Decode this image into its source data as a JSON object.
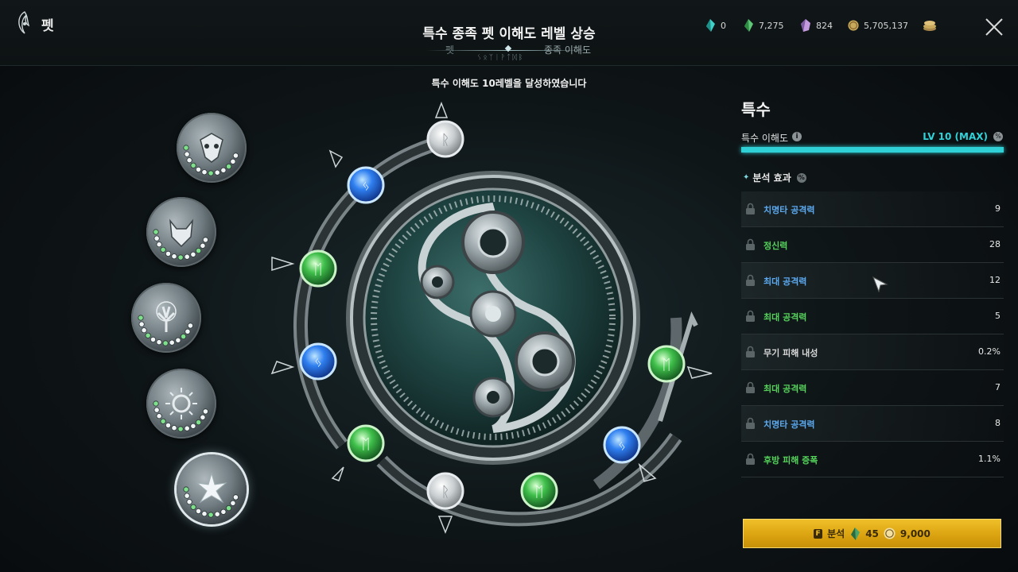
{
  "header": {
    "app_title": "펫",
    "center_title": "특수 종족 펫 이해도 레벨 상승",
    "tabs": [
      {
        "label": "펫"
      },
      {
        "label": "종족 이해도"
      }
    ],
    "rune_text": "ᛊᛟᛉᛁᚹᛏᛞᛒ"
  },
  "currencies": [
    {
      "icon": "blue-crystal-icon",
      "value": "0",
      "color": "#3fd0c8"
    },
    {
      "icon": "green-crystal-icon",
      "value": "7,275",
      "color": "#5fc878"
    },
    {
      "icon": "purple-crystal-icon",
      "value": "824",
      "color": "#c49adf"
    },
    {
      "icon": "gold-coin-icon",
      "value": "5,705,137",
      "color": "#d6b45a"
    },
    {
      "icon": "coin-stack-icon",
      "value": "",
      "color": "#c9a95b"
    }
  ],
  "toast": "특수 이해도 10레벨을 달성하였습니다",
  "species_nodes": [
    {
      "icon": "owl-mask-icon"
    },
    {
      "icon": "wolf-head-icon"
    },
    {
      "icon": "tree-icon"
    },
    {
      "icon": "sun-swirl-icon"
    },
    {
      "icon": "star-flower-icon",
      "selected": true
    }
  ],
  "panel": {
    "title": "특수",
    "understanding_label": "특수 이해도",
    "level_text": "LV 10 (MAX)",
    "progress": 1.0,
    "section_title": "분석 효과",
    "effects": [
      {
        "name": "치명타 공격력",
        "value": "9",
        "color": "#5aa9f0"
      },
      {
        "name": "정신력",
        "value": "28",
        "color": "#54d25a"
      },
      {
        "name": "최대 공격력",
        "value": "12",
        "color": "#5aa9f0"
      },
      {
        "name": "최대 공격력",
        "value": "5",
        "color": "#54d25a"
      },
      {
        "name": "무기 피해 내성",
        "value": "0.2%",
        "color": "#d8d8d8"
      },
      {
        "name": "최대 공격력",
        "value": "7",
        "color": "#54d25a"
      },
      {
        "name": "치명타 공격력",
        "value": "8",
        "color": "#5aa9f0"
      },
      {
        "name": "후방 피해 증폭",
        "value": "1.1%",
        "color": "#54d25a"
      }
    ],
    "analyze_button": {
      "key": "F",
      "label": "분석",
      "crystal_cost": "45",
      "gold_cost": "9,000"
    }
  },
  "colors": {
    "accent": "#2fd0d6",
    "gold_button": "#e2ae18",
    "rune_blue": "#2f7ff0",
    "rune_green": "#3fbf4a",
    "rune_grey": "#c8cdcf"
  }
}
